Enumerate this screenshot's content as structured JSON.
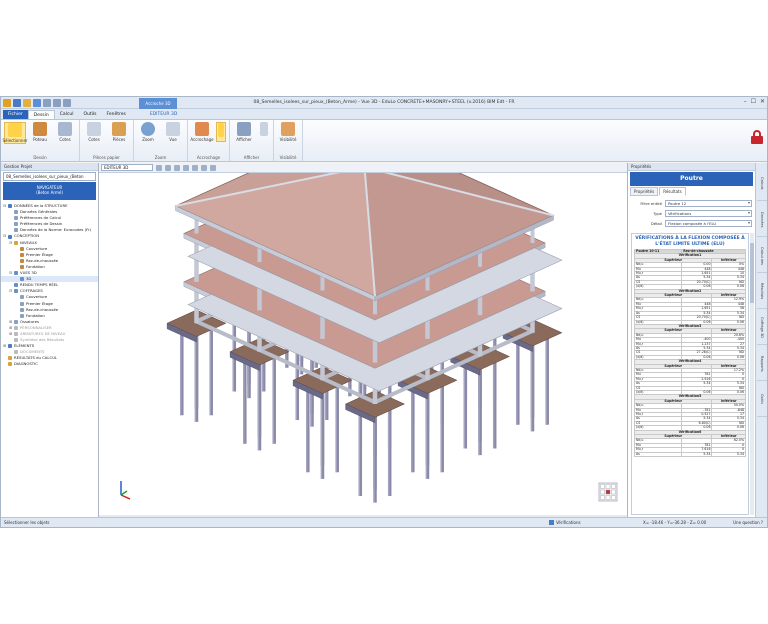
{
  "window": {
    "title": "08_Semelles_isolees_sur_pieux_(Beton_Arme) - Vue 3D - EduLo CONCRETE+MASONRY+STEEL (v.2016) BIM Edt - FR",
    "context_tab": "Accroche 3D",
    "min": "–",
    "max": "☐",
    "close": "✕"
  },
  "ribbon_tabs": [
    "Fichier",
    "Dessin",
    "Calcul",
    "Outils",
    "Fenêtres",
    "EDITEUR 3D"
  ],
  "ribbon": {
    "groups": [
      {
        "label": "Dessin",
        "buttons": [
          "Sélectionner",
          "Poteau",
          "Cotes"
        ]
      },
      {
        "label": "Pièces papier",
        "buttons": [
          "Cotes",
          "Pièces"
        ]
      },
      {
        "label": "Zoom",
        "buttons": [
          "Zoom",
          "Vue"
        ]
      },
      {
        "label": "Accrochage",
        "buttons": [
          "Accrochage"
        ]
      },
      {
        "label": "Afficher",
        "buttons": [
          "Afficher"
        ]
      },
      {
        "label": "Visibilité",
        "buttons": [
          "Visibilité"
        ]
      }
    ]
  },
  "left_panel": {
    "header": "Gestion Projet",
    "project_combo": "08_Semelles_isolees_sur_pieux_(Beton",
    "navigator_title": "NAVIGATEUR",
    "navigator_sub": "(Beton Armé)",
    "tree": [
      {
        "level": 0,
        "toggle": "⊟",
        "label": "DONNÉES de la STRUCTURE",
        "color": "#4a7bc8",
        "dim": false
      },
      {
        "level": 1,
        "toggle": "",
        "label": "Données Générales",
        "color": "#8aa0c0",
        "dim": false
      },
      {
        "level": 1,
        "toggle": "",
        "label": "Préférences de Calcul",
        "color": "#8aa0c0",
        "dim": false
      },
      {
        "level": 1,
        "toggle": "",
        "label": "Préférences de Dessin",
        "color": "#8aa0c0",
        "dim": false
      },
      {
        "level": 1,
        "toggle": "",
        "label": "Données de la Norme: Eurocodes (Fr)",
        "color": "#8aa0c0",
        "dim": false
      },
      {
        "level": 0,
        "toggle": "⊟",
        "label": "CONCEPTION",
        "color": "#4a7bc8",
        "dim": false
      },
      {
        "level": 1,
        "toggle": "⊟",
        "label": "NIVEAUX",
        "color": "#d9a23a",
        "dim": false
      },
      {
        "level": 2,
        "toggle": "",
        "label": "Couverture",
        "color": "#c08a3a",
        "dim": false
      },
      {
        "level": 2,
        "toggle": "",
        "label": "Premier Étage",
        "color": "#c08a3a",
        "dim": false
      },
      {
        "level": 2,
        "toggle": "",
        "label": "Rez-de-chaussée",
        "color": "#c08a3a",
        "dim": false
      },
      {
        "level": 2,
        "toggle": "",
        "label": "Fondation",
        "color": "#c08a3a",
        "dim": false
      },
      {
        "level": 1,
        "toggle": "⊟",
        "label": "VUES 3D",
        "color": "#6a8fc8",
        "dim": false
      },
      {
        "level": 2,
        "toggle": "",
        "label": "3D",
        "color": "#6a8fc8",
        "dim": false,
        "selected": true
      },
      {
        "level": 1,
        "toggle": "",
        "label": "RENDU TEMPS RÉEL",
        "color": "#6a8fc8",
        "dim": false
      },
      {
        "level": 1,
        "toggle": "⊟",
        "label": "COFFRAGES",
        "color": "#6a8fc8",
        "dim": false
      },
      {
        "level": 2,
        "toggle": "",
        "label": "Couverture",
        "color": "#8aa0c0",
        "dim": false
      },
      {
        "level": 2,
        "toggle": "",
        "label": "Premier Étage",
        "color": "#8aa0c0",
        "dim": false
      },
      {
        "level": 2,
        "toggle": "",
        "label": "Rez-de-chaussée",
        "color": "#8aa0c0",
        "dim": false
      },
      {
        "level": 2,
        "toggle": "",
        "label": "Fondation",
        "color": "#8aa0c0",
        "dim": false
      },
      {
        "level": 1,
        "toggle": "⊞",
        "label": "Ossatures",
        "color": "#8aa0c0",
        "dim": false
      },
      {
        "level": 1,
        "toggle": "⊞",
        "label": "PERSONNALISER",
        "color": "#bbbbbb",
        "dim": true
      },
      {
        "level": 1,
        "toggle": "⊞",
        "label": "ARMATURES DE NIVEAU",
        "color": "#bbbbbb",
        "dim": true
      },
      {
        "level": 1,
        "toggle": "",
        "label": "Synthèse des Résultats",
        "color": "#bbbbbb",
        "dim": true
      },
      {
        "level": 0,
        "toggle": "⊞",
        "label": "ÉLÉMENTS",
        "color": "#4a7bc8",
        "dim": false
      },
      {
        "level": 1,
        "toggle": "",
        "label": "DOCUMENTS",
        "color": "#bbbbbb",
        "dim": true
      },
      {
        "level": 0,
        "toggle": "",
        "label": "RÉSULTATS du CALCUL",
        "color": "#d9a23a",
        "dim": false
      },
      {
        "level": 0,
        "toggle": "",
        "label": "DIAGNOSTIC",
        "color": "#d9a23a",
        "dim": false
      }
    ]
  },
  "viewer": {
    "combo": "EDITEUR 3D"
  },
  "right_panel": {
    "header": "Propriétés",
    "title": "Poutre",
    "tabs": [
      "Propriétés",
      "Résultats"
    ],
    "fields": [
      {
        "label": "Filtre entité",
        "value": "Poutre 12"
      },
      {
        "label": "Type",
        "value": "Vérifications"
      },
      {
        "label": "Détail",
        "value": "Flexion composée à l'ELU"
      }
    ],
    "report_title": "VÉRIFICATIONS À LA FLEXION COMPOSÉE À L'ÉTAT LIMITE ULTIME (ELU)",
    "report_head": [
      "Poutre 10-11",
      "Rez-de-chaussée"
    ],
    "sections": [
      {
        "title": "Vérification1",
        "rows": [
          [
            "Nd,u",
            "0.00",
            "0%"
          ],
          [
            "Mu",
            "448",
            "448"
          ],
          [
            "Mu,r",
            "1.651",
            "10"
          ],
          [
            "As",
            "5.34",
            "5.34"
          ],
          [
            "CS",
            "20.70(C)",
            "ND"
          ],
          [
            "(x/d)",
            "0.06",
            "0.06"
          ]
        ]
      },
      {
        "title": "Vérification2",
        "rows": [
          [
            "Nd,u",
            "",
            "12.9%"
          ],
          [
            "Mu",
            "448",
            "448"
          ],
          [
            "Mu,r",
            "1.651",
            "56"
          ],
          [
            "As",
            "5.34",
            "5.34"
          ],
          [
            "CS",
            "20.70(C)",
            "ND"
          ],
          [
            "(x/d)",
            "0.06",
            "0.06"
          ]
        ]
      },
      {
        "title": "Vérification3",
        "rows": [
          [
            "Nd,u",
            "",
            "20.6%"
          ],
          [
            "Mu",
            "-400",
            "-400"
          ],
          [
            "Mu,r",
            "1.237",
            "27"
          ],
          [
            "As",
            "5.34",
            "5.34"
          ],
          [
            "CS",
            "27.28(C)",
            "ND"
          ],
          [
            "(x/d)",
            "0.06",
            "0.06"
          ]
        ]
      },
      {
        "title": "Vérification4",
        "rows": [
          [
            "Nd,u",
            "",
            "17.2%"
          ],
          [
            "Mu",
            "781",
            "0"
          ],
          [
            "Mu,r",
            "2.916",
            "0"
          ],
          [
            "As",
            "5.34",
            "5.34"
          ],
          [
            "CS",
            "",
            "ND"
          ],
          [
            "(x/d)",
            "0.06",
            "0.06"
          ]
        ]
      },
      {
        "title": "Vérification5",
        "rows": [
          [
            "Nd,u",
            "",
            "50.0%"
          ],
          [
            "Mu",
            "-781",
            "-848"
          ],
          [
            "Mu,r",
            "0.527",
            "17"
          ],
          [
            "As",
            "5.34",
            "5.34"
          ],
          [
            "CS",
            "6.80(C)",
            "ND"
          ],
          [
            "(x/d)",
            "0.06",
            "0.06"
          ]
        ]
      },
      {
        "title": "Vérification6",
        "rows": [
          [
            "Nd,u",
            "",
            "62.0%"
          ],
          [
            "Mu",
            "781",
            "0"
          ],
          [
            "Mu,r",
            "7.616",
            "0"
          ],
          [
            "As",
            "5.34",
            "5.34"
          ]
        ]
      }
    ],
    "sub_head": [
      "Supérieur",
      "Inférieur"
    ]
  },
  "side_tabs": [
    "Calculs",
    "Données générales",
    "Calcul des paramètres",
    "Résultats",
    "Coffrage 3D",
    "Rapports",
    "Outils"
  ],
  "statusbar": {
    "left": "Sélectionner les objets",
    "middle": "Vérifications",
    "coords": "X= -18.46 - Y=-36.28 - Z= 0.00",
    "right": "Une question ?"
  }
}
